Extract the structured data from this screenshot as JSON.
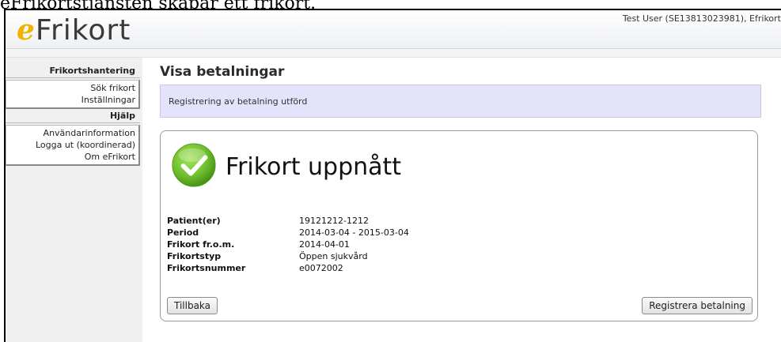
{
  "caption": "eFrikortstjänsten skapar ett frikort.",
  "app": {
    "logo_prefix": "e",
    "logo_name": "Frikort",
    "user_info": "Test User (SE13813023981), Efrikort"
  },
  "sidebar": {
    "section1_heading": "Frikortshantering",
    "section1_items": [
      "Sök frikort",
      "Inställningar"
    ],
    "section2_heading": "Hjälp",
    "section2_items": [
      "Användarinformation",
      "Logga ut (koordinerad)",
      "Om eFrikort"
    ]
  },
  "main": {
    "title": "Visa betalningar",
    "notice": "Registrering av betalning utförd",
    "result_heading": "Frikort uppnått",
    "details": [
      {
        "label": "Patient(er)",
        "value": "19121212-1212"
      },
      {
        "label": "Period",
        "value": "2014-03-04 - 2015-03-04"
      },
      {
        "label": "Frikort fr.o.m.",
        "value": "2014-04-01"
      },
      {
        "label": "Frikortstyp",
        "value": "Öppen sjukvård"
      },
      {
        "label": "Frikortsnummer",
        "value": "e0072002"
      }
    ],
    "back_label": "Tillbaka",
    "register_label": "Registrera betalning"
  },
  "colors": {
    "logo_accent": "#f0b400",
    "notice_bg": "#e3e4fb",
    "check_green": "#6fbe2e"
  },
  "icons": {
    "success": "check-circle-icon"
  }
}
